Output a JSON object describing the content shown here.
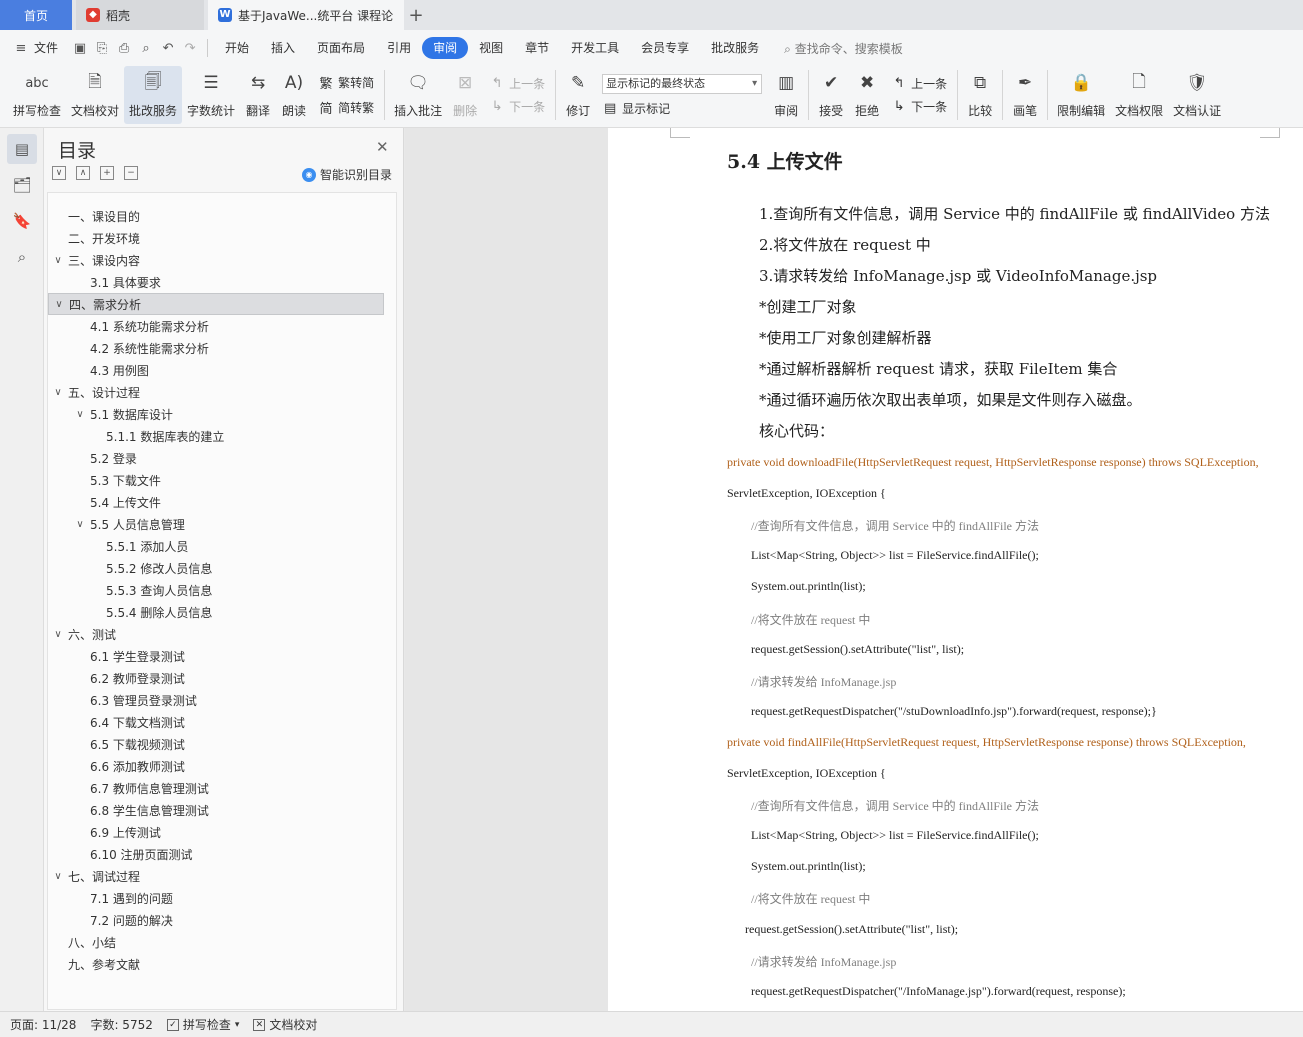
{
  "tabs": {
    "home": "首页",
    "daoke": "稻壳",
    "doc": "基于JavaWe...统平台 课程论",
    "plus": "+"
  },
  "menu": {
    "file": "文件",
    "items": [
      "开始",
      "插入",
      "页面布局",
      "引用",
      "审阅",
      "视图",
      "章节",
      "开发工具",
      "会员专享",
      "批改服务"
    ],
    "active": "审阅",
    "search": "查找命令、搜索模板"
  },
  "ribbon": {
    "spell": "拼写检查",
    "proof": "文档校对",
    "review_service": "批改服务",
    "word_count": "字数统计",
    "translate": "翻译",
    "read": "朗读",
    "to_trad": "繁转简",
    "to_simp": "简转繁",
    "insert_comment": "插入批注",
    "delete": "删除",
    "prev_item": "上一条",
    "next_item": "下一条",
    "track": "修订",
    "markup_select": "显示标记的最终状态",
    "show_markup": "显示标记",
    "review_pane": "审阅",
    "accept": "接受",
    "reject": "拒绝",
    "prev": "上一条",
    "next": "下一条",
    "compare": "比较",
    "pen": "画笔",
    "restrict": "限制编辑",
    "permission": "文档权限",
    "certify": "文档认证"
  },
  "toc": {
    "title": "目录",
    "smart": "智能识别目录",
    "items": [
      {
        "text": "一、课设目的",
        "level": 1,
        "chev": ""
      },
      {
        "text": "二、开发环境",
        "level": 1,
        "chev": ""
      },
      {
        "text": "三、课设内容",
        "level": 1,
        "chev": "∨"
      },
      {
        "text": "3.1 具体要求",
        "level": 2,
        "chev": ""
      },
      {
        "text": "四、需求分析",
        "level": 1,
        "chev": "∨"
      },
      {
        "text": "4.1 系统功能需求分析",
        "level": 2,
        "chev": ""
      },
      {
        "text": "4.2 系统性能需求分析",
        "level": 2,
        "chev": ""
      },
      {
        "text": "4.3 用例图",
        "level": 2,
        "chev": ""
      },
      {
        "text": "五、设计过程",
        "level": 1,
        "chev": "∨"
      },
      {
        "text": "5.1 数据库设计",
        "level": 2,
        "chev": "∨"
      },
      {
        "text": "5.1.1 数据库表的建立",
        "level": 3,
        "chev": ""
      },
      {
        "text": "5.2 登录",
        "level": 2,
        "chev": ""
      },
      {
        "text": "5.3 下载文件",
        "level": 2,
        "chev": ""
      },
      {
        "text": "5.4 上传文件",
        "level": 2,
        "chev": ""
      },
      {
        "text": "5.5 人员信息管理",
        "level": 2,
        "chev": "∨"
      },
      {
        "text": "5.5.1 添加人员",
        "level": 3,
        "chev": ""
      },
      {
        "text": "5.5.2 修改人员信息",
        "level": 3,
        "chev": ""
      },
      {
        "text": "5.5.3 查询人员信息",
        "level": 3,
        "chev": ""
      },
      {
        "text": "5.5.4 删除人员信息",
        "level": 3,
        "chev": ""
      },
      {
        "text": "六、测试",
        "level": 1,
        "chev": "∨"
      },
      {
        "text": "6.1 学生登录测试",
        "level": 2,
        "chev": ""
      },
      {
        "text": "6.2 教师登录测试",
        "level": 2,
        "chev": ""
      },
      {
        "text": "6.3 管理员登录测试",
        "level": 2,
        "chev": ""
      },
      {
        "text": "6.4 下载文档测试",
        "level": 2,
        "chev": ""
      },
      {
        "text": "6.5 下载视频测试",
        "level": 2,
        "chev": ""
      },
      {
        "text": "6.6 添加教师测试",
        "level": 2,
        "chev": ""
      },
      {
        "text": "6.7 教师信息管理测试",
        "level": 2,
        "chev": ""
      },
      {
        "text": "6.8 学生信息管理测试",
        "level": 2,
        "chev": ""
      },
      {
        "text": "6.9 上传测试",
        "level": 2,
        "chev": ""
      },
      {
        "text": "6.10 注册页面测试",
        "level": 2,
        "chev": ""
      },
      {
        "text": "七、调试过程",
        "level": 1,
        "chev": "∨"
      },
      {
        "text": "7.1 遇到的问题",
        "level": 2,
        "chev": ""
      },
      {
        "text": "7.2 问题的解决",
        "level": 2,
        "chev": ""
      },
      {
        "text": "八、小结",
        "level": 1,
        "chev": ""
      },
      {
        "text": "九、参考文献",
        "level": 1,
        "chev": ""
      }
    ],
    "selected_index": 4
  },
  "doc": {
    "heading": "5.4 上传文件",
    "paras": [
      "1.查询所有文件信息，调用 Service 中的 findAllFile 或 findAllVideo 方法",
      "2.将文件放在 request 中",
      "3.请求转发给 InfoManage.jsp 或 VideoInfoManage.jsp",
      "*创建工厂对象",
      "*使用工厂对象创建解析器",
      "*通过解析器解析 request 请求，获取 FileItem 集合",
      "*通过循环遍历依次取出表单项，如果是文件则存入磁盘。",
      "核心代码："
    ],
    "code": [
      "private  void  downloadFile(HttpServletRequest  request,  HttpServletResponse  response)  throws  SQLException,",
      "ServletException, IOException {",
      "//查询所有文件信息，调用 Service 中的 findAllFile 方法",
      "List<Map<String, Object>> list = FileService.findAllFile();",
      "System.out.println(list);",
      "//将文件放在 request 中",
      "request.getSession().setAttribute(\"list\", list);",
      "//请求转发给 InfoManage.jsp",
      "request.getRequestDispatcher(\"/stuDownloadInfo.jsp\").forward(request, response);}",
      "private  void  findAllFile(HttpServletRequest  request,  HttpServletResponse  response)  throws  SQLException,",
      "ServletException, IOException {",
      "//查询所有文件信息，调用 Service 中的 findAllFile 方法",
      "List<Map<String, Object>> list = FileService.findAllFile();",
      "System.out.println(list);",
      "//将文件放在 request 中",
      "request.getSession().setAttribute(\"list\", list);",
      "//请求转发给 InfoManage.jsp",
      "request.getRequestDispatcher(\"/InfoManage.jsp\").forward(request, response);"
    ]
  },
  "status": {
    "page": "页面: 11/28",
    "words": "字数: 5752",
    "spell": "拼写检查",
    "proof": "文档校对"
  },
  "colors": {
    "accent": "#2f75e6",
    "home_tab": "#4a7ee0",
    "keyword": "#b0601a"
  }
}
